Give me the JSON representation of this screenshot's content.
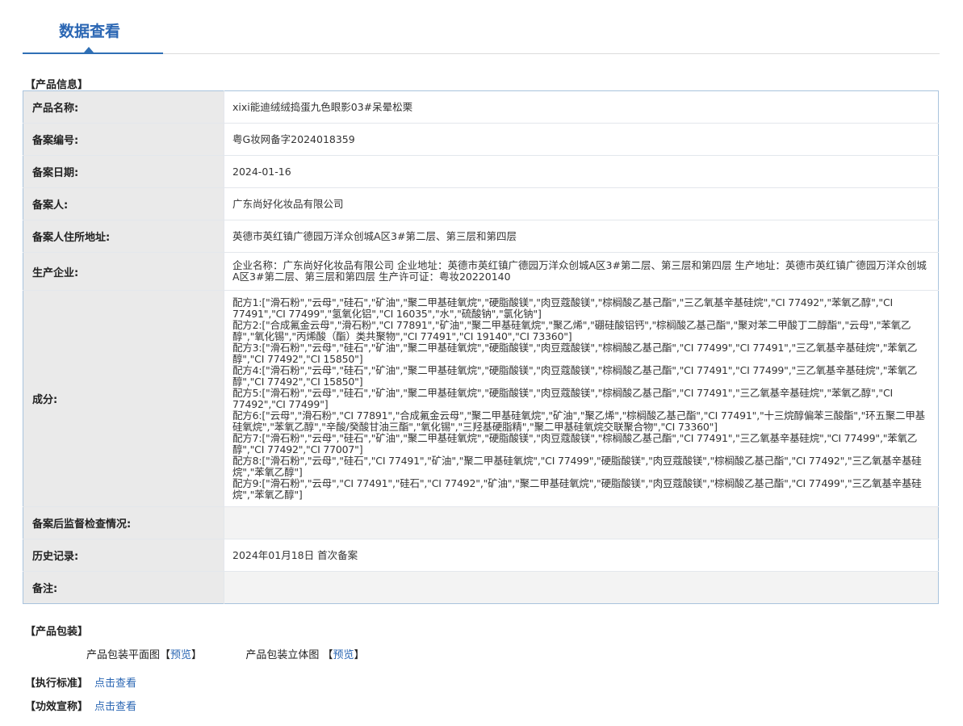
{
  "header": {
    "tab_title": "数据查看"
  },
  "product_info": {
    "section_title": "【产品信息】",
    "rows": [
      {
        "label": "产品名称:",
        "value": "xixi能迪绒绒捣蛋九色眼影03#呆晕松栗"
      },
      {
        "label": "备案编号:",
        "value": "粤G妆网备字2024018359"
      },
      {
        "label": "备案日期:",
        "value": "2024-01-16"
      },
      {
        "label": "备案人:",
        "value": "广东尚好化妆品有限公司"
      },
      {
        "label": "备案人住所地址:",
        "value": "英德市英红镇广德园万洋众创城A区3#第二层、第三层和第四层"
      },
      {
        "label": "生产企业:",
        "value": "企业名称：广东尚好化妆品有限公司 企业地址：英德市英红镇广德园万洋众创城A区3#第二层、第三层和第四层 生产地址：英德市英红镇广德园万洋众创城A区3#第二层、第三层和第四层 生产许可证：粤妆20220140"
      }
    ],
    "ingredients_label": "成分:",
    "formulas": [
      "配方1:[\"滑石粉\",\"云母\",\"硅石\",\"矿油\",\"聚二甲基硅氧烷\",\"硬脂酸镁\",\"肉豆蔻酸镁\",\"棕榈酸乙基己酯\",\"三乙氧基辛基硅烷\",\"CI 77492\",\"苯氧乙醇\",\"CI 77491\",\"CI 77499\",\"氢氧化铝\",\"CI 16035\",\"水\",\"硫酸钠\",\"氯化钠\"]",
      "配方2:[\"合成氟金云母\",\"滑石粉\",\"CI 77891\",\"矿油\",\"聚二甲基硅氧烷\",\"聚乙烯\",\"硼硅酸铝钙\",\"棕榈酸乙基己酯\",\"聚对苯二甲酸丁二醇酯\",\"云母\",\"苯氧乙醇\",\"氧化锡\",\"丙烯酸（酯）类共聚物\",\"CI 77491\",\"CI 19140\",\"CI 73360\"]",
      "配方3:[\"滑石粉\",\"云母\",\"硅石\",\"矿油\",\"聚二甲基硅氧烷\",\"硬脂酸镁\",\"肉豆蔻酸镁\",\"棕榈酸乙基己酯\",\"CI 77499\",\"CI 77491\",\"三乙氧基辛基硅烷\",\"苯氧乙醇\",\"CI 77492\",\"CI 15850\"]",
      "配方4:[\"滑石粉\",\"云母\",\"硅石\",\"矿油\",\"聚二甲基硅氧烷\",\"硬脂酸镁\",\"肉豆蔻酸镁\",\"棕榈酸乙基己酯\",\"CI 77491\",\"CI 77499\",\"三乙氧基辛基硅烷\",\"苯氧乙醇\",\"CI 77492\",\"CI 15850\"]",
      "配方5:[\"滑石粉\",\"云母\",\"硅石\",\"矿油\",\"聚二甲基硅氧烷\",\"硬脂酸镁\",\"肉豆蔻酸镁\",\"棕榈酸乙基己酯\",\"CI 77491\",\"三乙氧基辛基硅烷\",\"苯氧乙醇\",\"CI 77492\",\"CI 77499\"]",
      "配方6:[\"云母\",\"滑石粉\",\"CI 77891\",\"合成氟金云母\",\"聚二甲基硅氧烷\",\"矿油\",\"聚乙烯\",\"棕榈酸乙基己酯\",\"CI 77491\",\"十三烷醇偏苯三酸酯\",\"环五聚二甲基硅氧烷\",\"苯氧乙醇\",\"辛酸/癸酸甘油三酯\",\"氧化锡\",\"三羟基硬脂精\",\"聚二甲基硅氧烷交联聚合物\",\"CI 73360\"]",
      "配方7:[\"滑石粉\",\"云母\",\"硅石\",\"矿油\",\"聚二甲基硅氧烷\",\"硬脂酸镁\",\"肉豆蔻酸镁\",\"棕榈酸乙基己酯\",\"CI 77491\",\"三乙氧基辛基硅烷\",\"CI 77499\",\"苯氧乙醇\",\"CI 77492\",\"CI 77007\"]",
      "配方8:[\"滑石粉\",\"云母\",\"硅石\",\"CI 77491\",\"矿油\",\"聚二甲基硅氧烷\",\"CI 77499\",\"硬脂酸镁\",\"肉豆蔻酸镁\",\"棕榈酸乙基己酯\",\"CI 77492\",\"三乙氧基辛基硅烷\",\"苯氧乙醇\"]",
      "配方9:[\"滑石粉\",\"云母\",\"CI 77491\",\"硅石\",\"CI 77492\",\"矿油\",\"聚二甲基硅氧烷\",\"硬脂酸镁\",\"肉豆蔻酸镁\",\"棕榈酸乙基己酯\",\"CI 77499\",\"三乙氧基辛基硅烷\",\"苯氧乙醇\"]"
    ],
    "tail_rows": [
      {
        "label": "备案后监督检查情况:",
        "value": ""
      },
      {
        "label": "历史记录:",
        "value": "2024年01月18日 首次备案"
      },
      {
        "label": "备注:",
        "value": ""
      }
    ]
  },
  "packaging": {
    "section_title": "【产品包装】",
    "flat_label": "产品包装平面图",
    "stereo_label": "产品包装立体图",
    "bracket_open": "【",
    "bracket_close": "】",
    "preview_link": "预览"
  },
  "standard": {
    "label": "【执行标准】",
    "link": "点击查看"
  },
  "efficacy": {
    "label": "【功效宣称】",
    "link": "点击查看"
  }
}
